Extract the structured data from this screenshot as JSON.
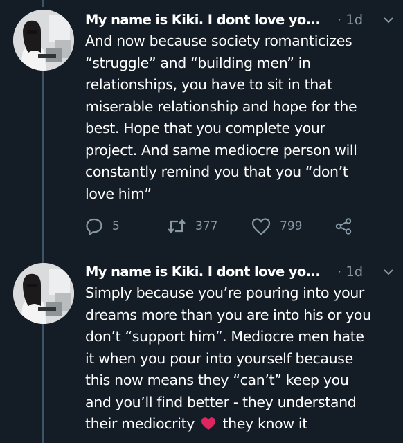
{
  "tweets": [
    {
      "author_name": "My name is Kiki. I dont love yo...",
      "time": "· 1d",
      "text_lines": [
        "And now because society romanticizes",
        "“struggle” and “building men” in",
        "relationships, you have to sit in that",
        "miserable relationship and hope for the",
        "best. Hope that you complete your",
        "project. And same mediocre person will",
        "constantly remind you that you “don’t",
        "love him”"
      ],
      "reply_count": "5",
      "retweet_count": "377",
      "like_count": "799"
    },
    {
      "author_name": "My name is Kiki. I dont love yo...",
      "time": "· 1d",
      "text_lines": [
        "Simply because you’re pouring into your",
        "dreams more than you are into his or you",
        "don’t “support him”. Mediocre men hate",
        "it when you pour into yourself because",
        "this now means they “can’t” keep you",
        "and you’ll find better - they understand"
      ],
      "last_line_before_emoji": "their mediocrity",
      "emoji": "heart",
      "last_line_after_emoji": "they know it"
    }
  ],
  "icons": {
    "reply": "reply-icon",
    "retweet": "retweet-icon",
    "like": "heart-icon",
    "share": "share-icon",
    "menu": "chevron-down-icon"
  },
  "colors": {
    "background": "#141d26",
    "text": "#ffffff",
    "muted": "#8899a6",
    "thread_line": "#3d5466",
    "heart_emoji": "#e0245e"
  }
}
